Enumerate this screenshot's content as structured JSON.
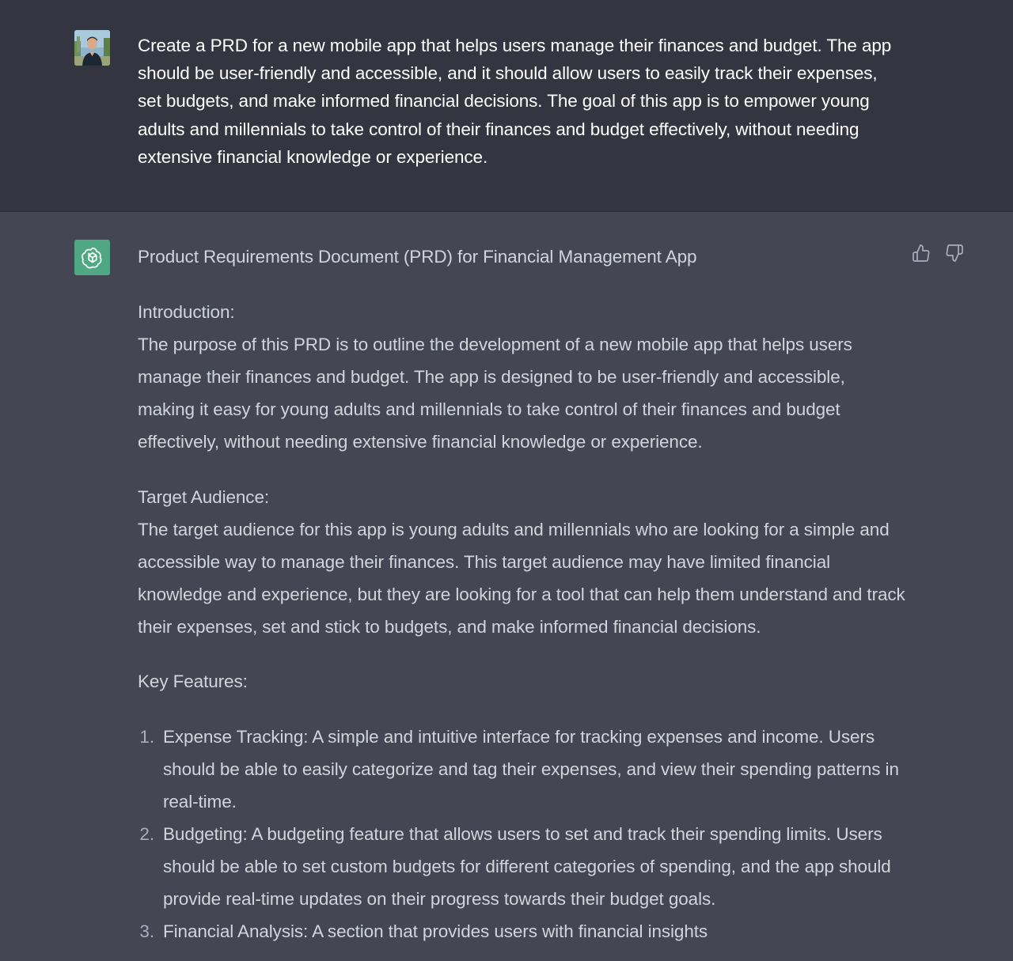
{
  "user_message": {
    "text": "Create a PRD for a new mobile app that helps users manage their finances and budget. The app should be user-friendly and accessible, and it should allow users to easily track their expenses, set budgets, and make informed financial decisions. The goal of this app is to empower young adults and millennials to take control of their finances and budget effectively, without needing extensive financial knowledge or experience."
  },
  "assistant_message": {
    "title": "Product Requirements Document (PRD) for Financial Management App",
    "sections": [
      {
        "heading": "Introduction:",
        "body": "The purpose of this PRD is to outline the development of a new mobile app that helps users manage their finances and budget. The app is designed to be user-friendly and accessible, making it easy for young adults and millennials to take control of their finances and budget effectively, without needing extensive financial knowledge or experience."
      },
      {
        "heading": "Target Audience:",
        "body": "The target audience for this app is young adults and millennials who are looking for a simple and accessible way to manage their finances. This target audience may have limited financial knowledge and experience, but they are looking for a tool that can help them understand and track their expenses, set and stick to budgets, and make informed financial decisions."
      }
    ],
    "key_features_heading": "Key Features:",
    "features": [
      {
        "number": "1.",
        "text": "Expense Tracking: A simple and intuitive interface for tracking expenses and income. Users should be able to easily categorize and tag their expenses, and view their spending patterns in real-time."
      },
      {
        "number": "2.",
        "text": "Budgeting: A budgeting feature that allows users to set and track their spending limits. Users should be able to set custom budgets for different categories of spending, and the app should provide real-time updates on their progress towards their budget goals."
      },
      {
        "number": "3.",
        "text": "Financial Analysis: A section that provides users with financial insights"
      }
    ]
  },
  "icons": {
    "user_avatar": "user-avatar-photo",
    "assistant_avatar": "openai-logo-icon",
    "thumbs_up": "thumbs-up-icon",
    "thumbs_down": "thumbs-down-icon"
  },
  "colors": {
    "user_bg": "#343541",
    "assistant_bg": "#444654",
    "assistant_avatar_bg": "#4fa883"
  }
}
